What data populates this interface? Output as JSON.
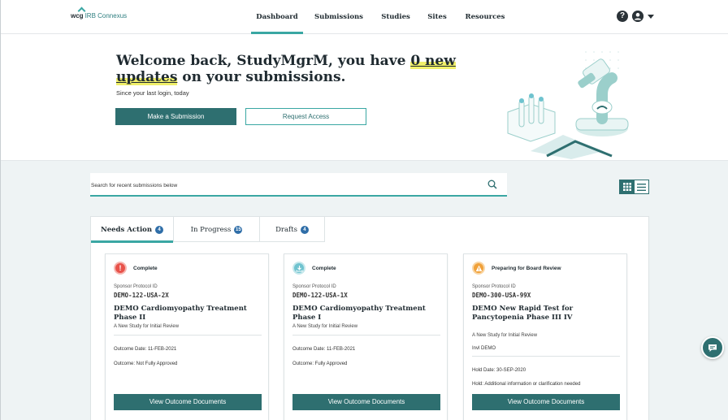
{
  "brand": {
    "wcg": "wcg",
    "name": "IRB Connexus"
  },
  "nav": [
    {
      "label": "Dashboard",
      "active": true
    },
    {
      "label": "Submissions",
      "active": false
    },
    {
      "label": "Studies",
      "active": false
    },
    {
      "label": "Sites",
      "active": false
    },
    {
      "label": "Resources",
      "active": false
    }
  ],
  "header_icons": {
    "help": "help-icon",
    "user": "user-icon",
    "menu": "chevron-down-icon"
  },
  "hero": {
    "welcome_pre": "Welcome back, StudyMgrM, you have ",
    "welcome_highlight": "0 new updates",
    "welcome_post": " on your submissions.",
    "since": "Since your last login, today",
    "primary_button": "Make a Submission",
    "secondary_button": "Request Access"
  },
  "search": {
    "placeholder": "Search for recent submissions below"
  },
  "tabs": [
    {
      "label": "Needs Action",
      "count": "4",
      "active": true
    },
    {
      "label": "In Progress",
      "count": "15",
      "active": false
    },
    {
      "label": "Drafts",
      "count": "4",
      "active": false
    }
  ],
  "cards": [
    {
      "status": "Complete",
      "status_icon": "alert-icon",
      "status_color": "#e8524a",
      "protocol_label": "Sponsor Protocol ID",
      "protocol_id": "DEMO-122-USA-2X",
      "title": "DEMO Cardiomyopathy Treatment Phase II",
      "subtitle": "A New Study for Initial Review",
      "lines": [
        "Outcome Date: 11-FEB-2021",
        "Outcome: Not Fully Approved"
      ],
      "button": "View Outcome Documents"
    },
    {
      "status": "Complete",
      "status_icon": "download-icon",
      "status_color": "#6fc3cf",
      "protocol_label": "Sponsor Protocol ID",
      "protocol_id": "DEMO-122-USA-1X",
      "title": "DEMO Cardiomyopathy Treatment Phase I",
      "subtitle": "A New Study for Initial Review",
      "lines": [
        "Outcome Date: 11-FEB-2021",
        "Outcome: Fully Approved"
      ],
      "button": "View Outcome Documents"
    },
    {
      "status": "Preparing for Board Review",
      "status_icon": "warning-icon",
      "status_color": "#f0a13a",
      "protocol_label": "Sponsor Protocol ID",
      "protocol_id": "DEMO-300-USA-99X",
      "title": "DEMO New Rapid Test for Pancytopenia Phase III IV",
      "subtitle": "A New Study for Initial Review",
      "extra": "Invl DEMO",
      "lines": [
        "Hold Date: 30-SEP-2020",
        "Hold: Additional information or clarification needed"
      ],
      "button": "View Outcome Documents"
    }
  ]
}
